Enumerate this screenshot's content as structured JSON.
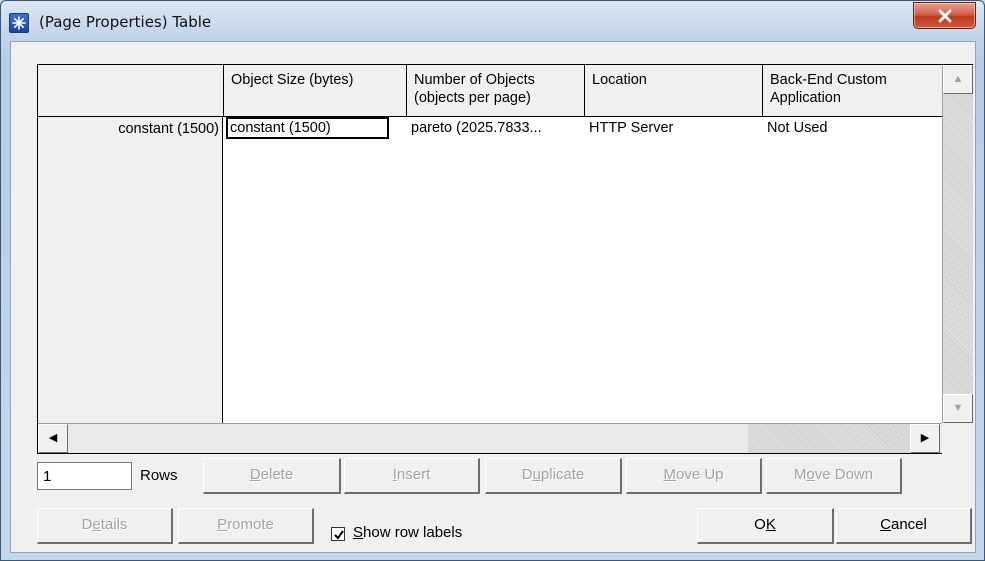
{
  "window": {
    "title": "(Page Properties) Table",
    "close_glyph": "✕",
    "icon": "star-icon"
  },
  "table": {
    "columns": [
      "",
      "Object Size (bytes)",
      "Number of Objects (objects per page)",
      "Location",
      "Back-End Custom Application"
    ],
    "rows": [
      {
        "label": "constant (1500)",
        "cells": [
          "constant (1500)",
          "pareto (2025.7833...",
          "HTTP Server",
          "Not Used"
        ]
      }
    ]
  },
  "controls": {
    "rows_value": "1",
    "rows_label": "Rows",
    "delete": {
      "pre": "",
      "key": "D",
      "post": "elete"
    },
    "insert": {
      "pre": "",
      "key": "I",
      "post": "nsert"
    },
    "duplicate": {
      "pre": "D",
      "key": "u",
      "post": "plicate"
    },
    "move_up": {
      "pre": "",
      "key": "M",
      "post": "ove Up"
    },
    "move_down": {
      "pre": "M",
      "key": "o",
      "post": "ve Down"
    },
    "details": {
      "pre": "D",
      "key": "e",
      "post": "tails"
    },
    "promote": {
      "pre": "",
      "key": "P",
      "post": "romote"
    },
    "show_row_labels": {
      "pre": "",
      "key": "S",
      "post": "how row labels",
      "checked": true
    },
    "ok": {
      "pre": "O",
      "key": "K",
      "post": ""
    },
    "cancel": {
      "pre": "",
      "key": "C",
      "post": "ancel"
    }
  },
  "colors": {
    "accent": "#1d4696",
    "close": "#c0391d",
    "disabled_text": "#a3a3a3"
  }
}
